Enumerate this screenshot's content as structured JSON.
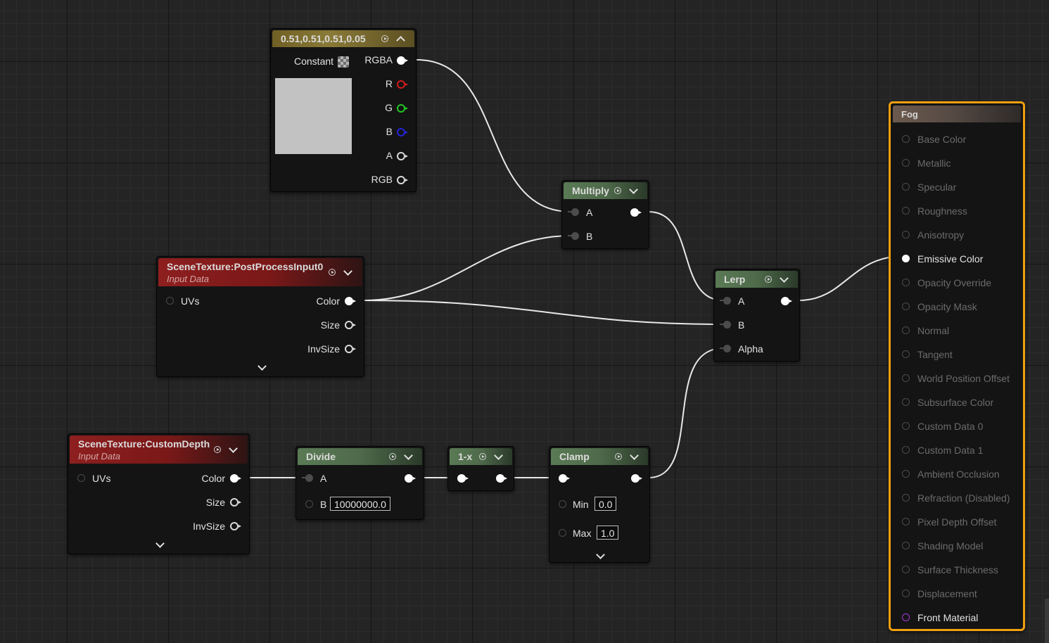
{
  "constant_node": {
    "title": "0.51,0.51,0.51,0.05",
    "label": "Constant",
    "outputs": [
      "RGBA",
      "R",
      "G",
      "B",
      "A",
      "RGB"
    ]
  },
  "postprocess_node": {
    "title": "SceneTexture:PostProcessInput0",
    "subtitle": "Input Data",
    "input": "UVs",
    "outputs": [
      "Color",
      "Size",
      "InvSize"
    ]
  },
  "customdepth_node": {
    "title": "SceneTexture:CustomDepth",
    "subtitle": "Input Data",
    "input": "UVs",
    "outputs": [
      "Color",
      "Size",
      "InvSize"
    ]
  },
  "multiply_node": {
    "title": "Multiply",
    "inputs": [
      "A",
      "B"
    ]
  },
  "lerp_node": {
    "title": "Lerp",
    "inputs": [
      "A",
      "B",
      "Alpha"
    ]
  },
  "divide_node": {
    "title": "Divide",
    "inputs": [
      "A",
      "B"
    ],
    "b_value": "10000000.0"
  },
  "oneminus_node": {
    "title": "1-x"
  },
  "clamp_node": {
    "title": "Clamp",
    "min_label": "Min",
    "min_value": "0.0",
    "max_label": "Max",
    "max_value": "1.0"
  },
  "fog_node": {
    "title": "Fog",
    "pins": [
      {
        "label": "Base Color",
        "active": false
      },
      {
        "label": "Metallic",
        "active": false
      },
      {
        "label": "Specular",
        "active": false
      },
      {
        "label": "Roughness",
        "active": false
      },
      {
        "label": "Anisotropy",
        "active": false
      },
      {
        "label": "Emissive Color",
        "active": true
      },
      {
        "label": "Opacity Override",
        "active": false
      },
      {
        "label": "Opacity Mask",
        "active": false
      },
      {
        "label": "Normal",
        "active": false
      },
      {
        "label": "Tangent",
        "active": false
      },
      {
        "label": "World Position Offset",
        "active": false
      },
      {
        "label": "Subsurface Color",
        "active": false
      },
      {
        "label": "Custom Data 0",
        "active": false
      },
      {
        "label": "Custom Data 1",
        "active": false
      },
      {
        "label": "Ambient Occlusion",
        "active": false
      },
      {
        "label": "Refraction (Disabled)",
        "active": false
      },
      {
        "label": "Pixel Depth Offset",
        "active": false
      },
      {
        "label": "Shading Model",
        "active": false
      },
      {
        "label": "Surface Thickness",
        "active": false
      },
      {
        "label": "Displacement",
        "active": false
      },
      {
        "label": "Front Material",
        "active": true
      }
    ]
  },
  "colors": {
    "selection_outline": "#f0a010",
    "constant_swatch": "#c2c2c2",
    "wire": "#e8e8e8",
    "pin_r": "#d01c1c",
    "pin_g": "#22c522",
    "pin_b": "#2424d8",
    "pin_front_material": "#a43ad8"
  },
  "icons": [
    "play-icon",
    "chevron-down-icon",
    "chevron-up-icon",
    "checker-swatch-icon",
    "pin-icon"
  ]
}
